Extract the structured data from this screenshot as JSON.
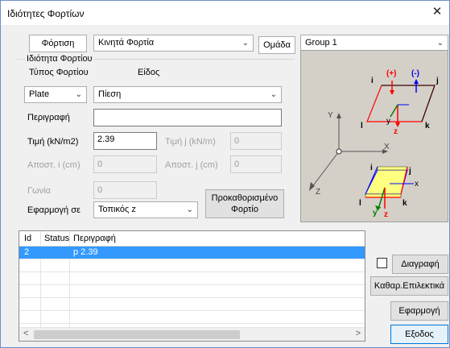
{
  "window": {
    "title": "Ιδιότητες Φορτίων",
    "close_glyph": "✕"
  },
  "top": {
    "tab_loading": "Φόρτιση",
    "load_kind": "Κινητά Φορτία",
    "tab_group": "Ομάδα",
    "group_value": "Group 1"
  },
  "props": {
    "group_title": "Ιδιότητα Φορτίου",
    "type_label": "Τύπος Φορτίου",
    "kind_label": "Είδος",
    "type_value": "Plate",
    "kind_value": "Πίεση",
    "description_label": "Περιγραφή",
    "description_value": "",
    "value_label": "Τιμή (kN/m2)",
    "value": "2.39",
    "value_j_label": "Τιμή j (kN/m)",
    "value_j": "0",
    "dist_i_label": "Αποστ. i (cm)",
    "dist_i": "0",
    "dist_j_label": "Αποστ. j (cm)",
    "dist_j": "0",
    "angle_label": "Γωνία",
    "angle": "0",
    "apply_label": "Εφαρμογή σε",
    "apply_value": "Τοπικός z",
    "predefined_line1": "Προκαθορισμένο",
    "predefined_line2": "Φορτίο"
  },
  "diagram": {
    "plus": "(+)",
    "minus": "(-)",
    "i": "i",
    "j": "j",
    "k": "k",
    "l": "l",
    "x": "X",
    "y": "Y",
    "z": "Z",
    "ly": "y",
    "lz": "z",
    "lx": "x"
  },
  "table": {
    "headers": [
      "Id",
      "Status",
      "Περιγραφή"
    ],
    "rows": [
      {
        "id": "2",
        "status": "",
        "description": "p  2.39"
      }
    ]
  },
  "actions": {
    "delete": "Διαγραφή",
    "clear_selected": "Καθαρ.Επιλεκτικά",
    "apply": "Εφαρμογή",
    "exit": "Εξοδος"
  },
  "colors": {
    "selection": "#3399ff",
    "plate_fill": "#ffff80",
    "red_edge": "#ff0000",
    "blue_edge": "#0000ff"
  }
}
